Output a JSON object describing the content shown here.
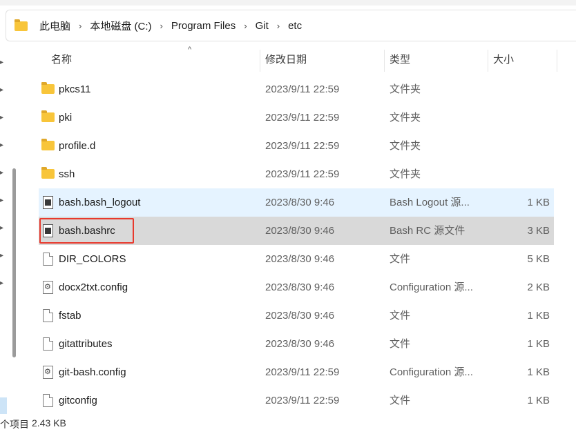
{
  "breadcrumb": [
    "此电脑",
    "本地磁盘 (C:)",
    "Program Files",
    "Git",
    "etc"
  ],
  "breadcrumb_separator": "›",
  "columns": {
    "name": "名称",
    "date": "修改日期",
    "type": "类型",
    "size": "大小"
  },
  "sort_indicator": "^",
  "files": [
    {
      "name": "pkcs11",
      "date": "2023/9/11 22:59",
      "type": "文件夹",
      "size": "",
      "icon": "folder-icon",
      "state": ""
    },
    {
      "name": "pki",
      "date": "2023/9/11 22:59",
      "type": "文件夹",
      "size": "",
      "icon": "folder-icon",
      "state": ""
    },
    {
      "name": "profile.d",
      "date": "2023/9/11 22:59",
      "type": "文件夹",
      "size": "",
      "icon": "folder-icon",
      "state": ""
    },
    {
      "name": "ssh",
      "date": "2023/9/11 22:59",
      "type": "文件夹",
      "size": "",
      "icon": "folder-icon",
      "state": ""
    },
    {
      "name": "bash.bash_logout",
      "date": "2023/8/30 9:46",
      "type": "Bash Logout 源...",
      "size": "1 KB",
      "icon": "script-file-icon",
      "state": "hover"
    },
    {
      "name": "bash.bashrc",
      "date": "2023/8/30 9:46",
      "type": "Bash RC 源文件",
      "size": "3 KB",
      "icon": "script-file-icon",
      "state": "selected"
    },
    {
      "name": "DIR_COLORS",
      "date": "2023/8/30 9:46",
      "type": "文件",
      "size": "5 KB",
      "icon": "file-icon",
      "state": ""
    },
    {
      "name": "docx2txt.config",
      "date": "2023/8/30 9:46",
      "type": "Configuration 源...",
      "size": "2 KB",
      "icon": "config-file-icon",
      "state": ""
    },
    {
      "name": "fstab",
      "date": "2023/8/30 9:46",
      "type": "文件",
      "size": "1 KB",
      "icon": "file-icon",
      "state": ""
    },
    {
      "name": "gitattributes",
      "date": "2023/8/30 9:46",
      "type": "文件",
      "size": "1 KB",
      "icon": "file-icon",
      "state": ""
    },
    {
      "name": "git-bash.config",
      "date": "2023/9/11 22:59",
      "type": "Configuration 源...",
      "size": "1 KB",
      "icon": "config-file-icon",
      "state": ""
    },
    {
      "name": "gitconfig",
      "date": "2023/9/11 22:59",
      "type": "文件",
      "size": "1 KB",
      "icon": "file-icon",
      "state": ""
    }
  ],
  "status": {
    "items_text": "个项目",
    "selected_size": "2.43 KB"
  },
  "colors": {
    "hover": "#e5f3ff",
    "selected": "#d9d9d9",
    "highlight": "#e8392d",
    "folder": "#f8c53a"
  }
}
